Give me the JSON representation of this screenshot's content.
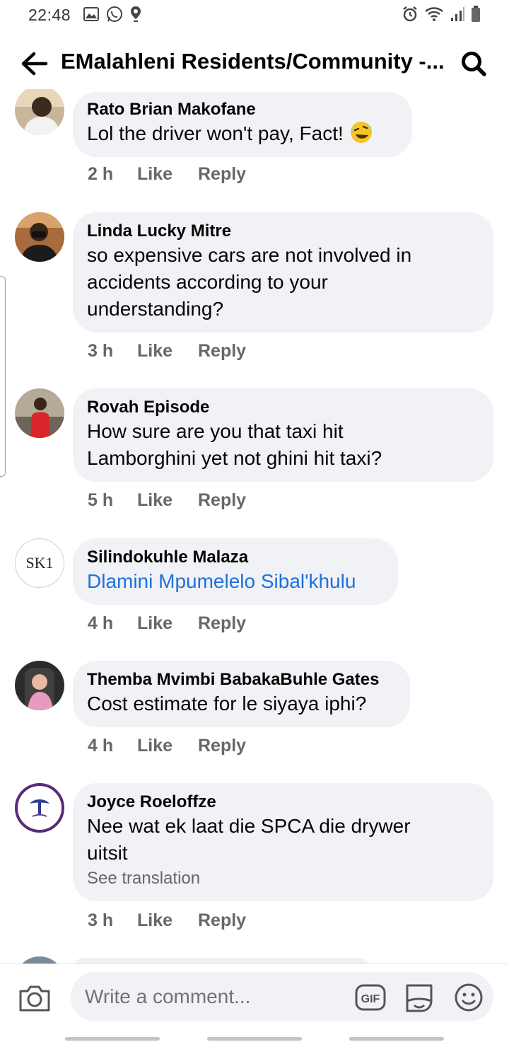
{
  "status_bar": {
    "time": "22:48"
  },
  "header": {
    "title": "EMalahleni Residents/Community -..."
  },
  "comments": [
    {
      "author": "Rato Brian Makofane",
      "text": "Lol the driver won't pay, Fact!",
      "time": "2 h",
      "like": "Like",
      "reply": "Reply"
    },
    {
      "author": "Linda Lucky Mitre",
      "line1": "so expensive cars are not involved in",
      "line2": "accidents according to your",
      "line3": "understanding?",
      "time": "3 h",
      "like": "Like",
      "reply": "Reply"
    },
    {
      "author": "Rovah Episode",
      "line1": "How sure are you that taxi hit",
      "line2": "Lamborghini yet not ghini hit taxi?",
      "time": "5 h",
      "like": "Like",
      "reply": "Reply"
    },
    {
      "author": "Silindokuhle Malaza",
      "avatar_text": "SK1",
      "text": "Dlamini Mpumelelo Sibal'khulu",
      "time": "4 h",
      "like": "Like",
      "reply": "Reply"
    },
    {
      "author": "Themba Mvimbi BabakaBuhle Gates",
      "text": "Cost estimate for le siyaya iphi?",
      "time": "4 h",
      "like": "Like",
      "reply": "Reply"
    },
    {
      "author": "Joyce Roeloffze",
      "line1": "Nee wat ek laat die SPCA die drywer",
      "line2": "uitsit",
      "see_translation": "See translation",
      "time": "3 h",
      "like": "Like",
      "reply": "Reply"
    }
  ],
  "composer": {
    "placeholder": "Write a comment..."
  },
  "colors": {
    "bubble": "#f0f2f5",
    "link": "#216fdb",
    "meta": "#65676b"
  }
}
